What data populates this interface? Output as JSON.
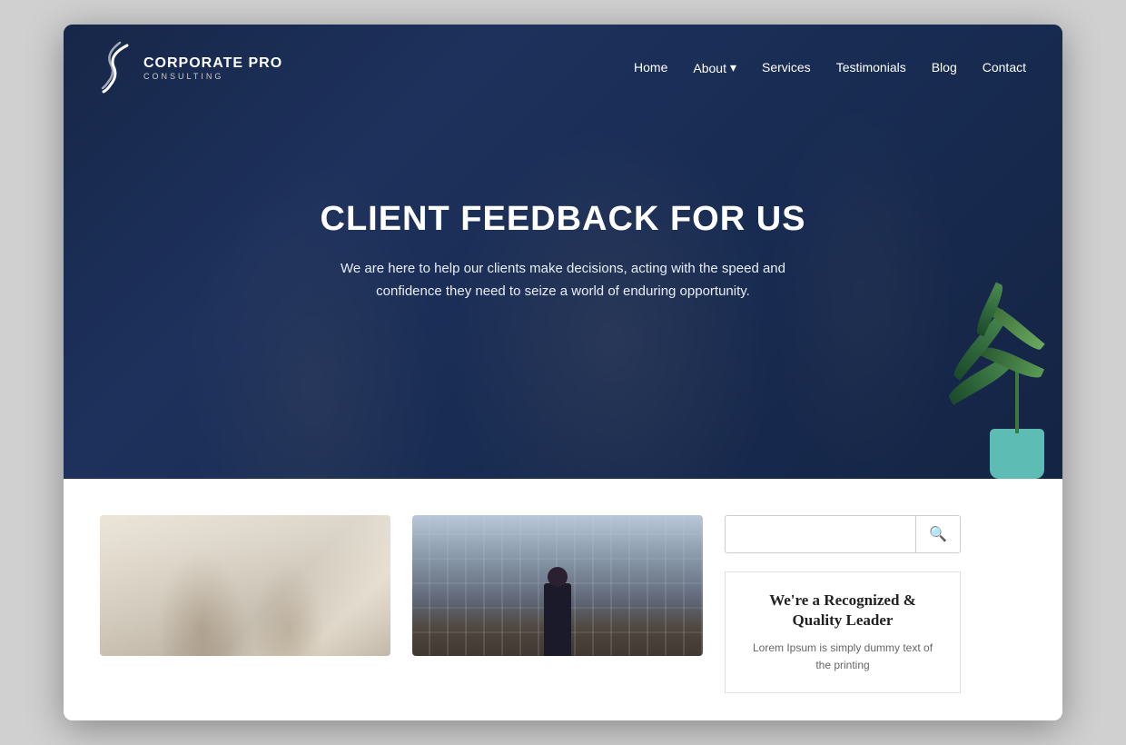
{
  "browser": {
    "title": "Corporate Pro Consulting"
  },
  "header": {
    "logo": {
      "brand": "CORPORATE PRO",
      "sub": "CONSULTING"
    },
    "nav": {
      "home": "Home",
      "about": "About",
      "about_arrow": "▾",
      "services": "Services",
      "testimonials": "Testimonials",
      "blog": "Blog",
      "contact": "Contact"
    }
  },
  "hero": {
    "title": "CLIENT FEEDBACK FOR US",
    "subtitle_line1": "We are here to help our clients make decisions, acting with the speed and",
    "subtitle_line2": "confidence they need to seize a world of enduring opportunity."
  },
  "bottom": {
    "card1_alt": "Business professionals in office",
    "card2_alt": "Person standing in front of historic building",
    "sidebar": {
      "search_placeholder": "",
      "search_icon": "🔍",
      "quality_title": "We're a Recognized & Quality Leader",
      "quality_text": "Lorem Ipsum is simply dummy text of the printing"
    }
  }
}
